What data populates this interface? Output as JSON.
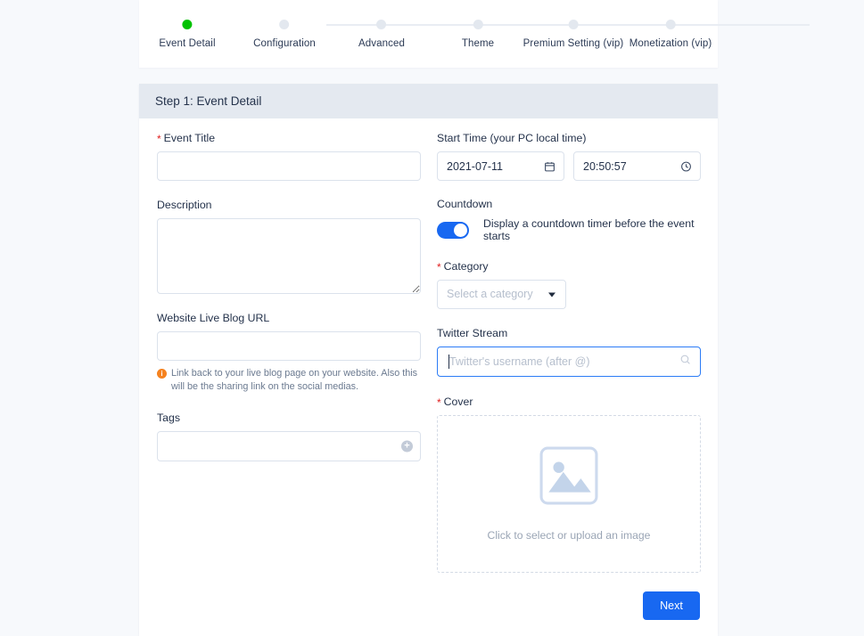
{
  "stepper": {
    "steps": [
      {
        "label": "Event Detail",
        "state": "active"
      },
      {
        "label": "Configuration",
        "state": "inactive"
      },
      {
        "label": "Advanced",
        "state": "inactive"
      },
      {
        "label": "Theme",
        "state": "inactive"
      },
      {
        "label": "Premium Setting (vip)",
        "state": "inactive"
      },
      {
        "label": "Monetization (vip)",
        "state": "inactive"
      }
    ],
    "active_color": "#00c200",
    "inactive_color": "#e3e8ef"
  },
  "card": {
    "header_title": "Step 1: Event Detail",
    "header_bg": "#e4e9f0"
  },
  "form": {
    "event_title": {
      "label": "Event Title",
      "required": true,
      "value": "",
      "placeholder": ""
    },
    "description": {
      "label": "Description",
      "required": false,
      "value": "",
      "placeholder": ""
    },
    "website_url": {
      "label": "Website Live Blog URL",
      "required": false,
      "value": "",
      "placeholder": "",
      "hint": "Link back to your live blog page on your website. Also this will be the sharing link on the social medias.",
      "hint_icon": "info-icon",
      "hint_icon_color": "#f5821f"
    },
    "tags": {
      "label": "Tags",
      "required": false,
      "value": "",
      "placeholder": "",
      "add_icon": "plus-circle-icon"
    },
    "start_time": {
      "label": "Start Time (your PC local time)",
      "required": false,
      "date_value": "2021-07-11",
      "date_icon": "calendar-icon",
      "time_value": "20:50:57",
      "time_icon": "clock-icon"
    },
    "countdown": {
      "label": "Countdown",
      "required": false,
      "toggle_on": true,
      "toggle_color": "#1868f1",
      "description": "Display a countdown timer before the event starts"
    },
    "category": {
      "label": "Category",
      "required": true,
      "selected": "Select a category",
      "caret_icon": "chevron-down-icon"
    },
    "twitter_stream": {
      "label": "Twitter Stream",
      "required": false,
      "value": "",
      "placeholder": "Twitter's username (after @)",
      "focused": true,
      "focus_color": "#2c7cf6",
      "search_icon": "search-icon"
    },
    "cover": {
      "label": "Cover",
      "required": true,
      "caption": "Click to select or upload an image",
      "placeholder_icon": "image-placeholder-icon"
    }
  },
  "footer": {
    "next_label": "Next",
    "next_color": "#1868f1"
  }
}
